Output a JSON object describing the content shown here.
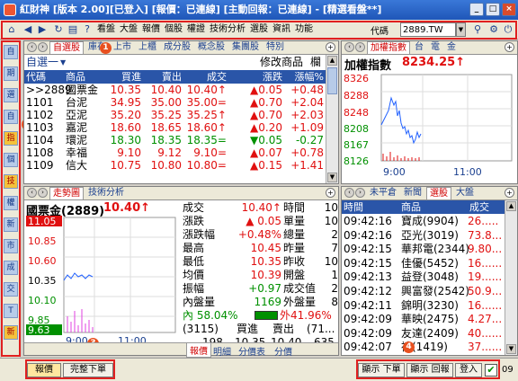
{
  "window": {
    "title": "紅財神 [版本 2.00][已登入] [報價：已連線] [主動回報：已連線] - [精選看盤**]",
    "buttons": [
      "_",
      "□",
      "×"
    ]
  },
  "toolbar": {
    "menu": [
      "看盤",
      "大盤",
      "報價",
      "個股",
      "權證",
      "技術分析",
      "選股",
      "資訊",
      "功能"
    ],
    "code_label": "代碼",
    "code_value": "2889.TW"
  },
  "sidebar": {
    "items": [
      "自",
      "期",
      "選",
      "自",
      "指",
      "個",
      "技",
      "權",
      "新",
      "市",
      "成",
      "交",
      "T",
      "新"
    ]
  },
  "watchlist": {
    "tabs": [
      "自選股",
      "庫存",
      "上市",
      "上櫃",
      "成分股",
      "概念股",
      "集團股",
      "特別"
    ],
    "group": "自選一",
    "modify": "修改商品",
    "field": "欄位",
    "columns": [
      "代碼",
      "商品",
      "買進",
      "賣出",
      "成交",
      "漲跌",
      "漲幅%"
    ],
    "rows": [
      {
        "code": ">>2889",
        "name": "國票金",
        "bid": "10.35",
        "ask": "10.40",
        "last": "10.40↑",
        "chg": "▲0.05",
        "pct": "+0.48",
        "dir": "up"
      },
      {
        "code": "1101",
        "name": "台泥",
        "bid": "34.95",
        "ask": "35.00",
        "last": "35.00=",
        "chg": "▲0.70",
        "pct": "+2.04",
        "dir": "up"
      },
      {
        "code": "1102",
        "name": "亞泥",
        "bid": "35.20",
        "ask": "35.25",
        "last": "35.25↑",
        "chg": "▲0.70",
        "pct": "+2.03",
        "dir": "up"
      },
      {
        "code": "1103",
        "name": "嘉泥",
        "bid": "18.60",
        "ask": "18.65",
        "last": "18.60↑",
        "chg": "▲0.20",
        "pct": "+1.09",
        "dir": "up"
      },
      {
        "code": "1104",
        "name": "環泥",
        "bid": "18.30",
        "ask": "18.35",
        "last": "18.35=",
        "chg": "▼0.05",
        "pct": "-0.27",
        "dir": "dn"
      },
      {
        "code": "1108",
        "name": "幸福",
        "bid": "9.10",
        "ask": "9.12",
        "last": "9.10=",
        "chg": "▲0.07",
        "pct": "+0.78",
        "dir": "up"
      },
      {
        "code": "1109",
        "name": "信大",
        "bid": "10.75",
        "ask": "10.80",
        "last": "10.80=",
        "chg": "▲0.15",
        "pct": "+1.41",
        "dir": "up"
      }
    ]
  },
  "index_panel": {
    "tabs": [
      "加權指數",
      "台",
      "電",
      "金"
    ],
    "title": "加權指數",
    "value": "8234.25↑",
    "y_ticks": [
      "8326",
      "8288",
      "8248",
      "8208",
      "8167",
      "8126"
    ],
    "x_ticks": [
      "9:00",
      "11:00"
    ]
  },
  "quote_panel": {
    "tabs": [
      "走勢圖",
      "技術分析"
    ],
    "stock": "國票金(2889)",
    "price": "10.40↑",
    "y_ticks": [
      "11.05",
      "10.85",
      "10.60",
      "10.35",
      "10.10",
      "9.85",
      "9.63"
    ],
    "x_ticks": [
      "9:00",
      "11:00"
    ],
    "fields": [
      {
        "label": "成交",
        "value": "10.40↑",
        "label2": "時間",
        "value2": "10"
      },
      {
        "label": "漲跌",
        "value": "▲ 0.05",
        "label2": "單量",
        "value2": "10"
      },
      {
        "label": "漲跌幅",
        "value": "+0.48%",
        "label2": "總量",
        "value2": "2"
      },
      {
        "label": "最高",
        "value": "10.45",
        "label2": "昨量",
        "value2": "7"
      },
      {
        "label": "最低",
        "value": "10.35",
        "label2": "昨收",
        "value2": "10"
      },
      {
        "label": "均價",
        "value": "10.39",
        "label2": "開盤",
        "value2": "1"
      },
      {
        "label": "振幅",
        "value": "+0.97",
        "label2": "成交值",
        "value2": "2"
      },
      {
        "label": "內盤量",
        "value": "1169",
        "label2": "外盤量",
        "value2": "8"
      }
    ],
    "inner_pct": "內 58.04%",
    "outer_pct": "外41.96%",
    "bidask_head": [
      "(3115)",
      "買進",
      "賣出",
      "(71..."
    ],
    "bidask_row": [
      "198",
      "10.35",
      "10.40",
      "635"
    ],
    "bottom_tabs": [
      "報價",
      "明細",
      "分價表",
      "分價"
    ]
  },
  "ticks_panel": {
    "tabs": [
      "未平倉",
      "新聞",
      "選股",
      "大盤"
    ],
    "columns": [
      "時間",
      "商品",
      "成交"
    ],
    "rows": [
      {
        "time": "09:42:16",
        "name": "寶成(9904)",
        "price": "26....."
      },
      {
        "time": "09:42:16",
        "name": "亞光(3019)",
        "price": "73.8..."
      },
      {
        "time": "09:42:15",
        "name": "華邦電(2344)",
        "price": "9.80..."
      },
      {
        "time": "09:42:15",
        "name": "佳優(5452)",
        "price": "16......"
      },
      {
        "time": "09:42:13",
        "name": "益登(3048)",
        "price": "19......"
      },
      {
        "time": "09:42:12",
        "name": "興富發(2542)",
        "price": "50.9..."
      },
      {
        "time": "09:42:11",
        "name": "錦明(3230)",
        "price": "16......"
      },
      {
        "time": "09:42:09",
        "name": "華映(2475)",
        "price": "4.27..."
      },
      {
        "time": "09:42:09",
        "name": "友達(2409)",
        "price": "40......"
      },
      {
        "time": "09:42:07",
        "name": "禧(1419)",
        "price": "37......"
      }
    ]
  },
  "bottombar": {
    "left_tabs": [
      "報價",
      "完整下單"
    ],
    "right_buttons": [
      "顯示 下單",
      "顯示 回報",
      "登入"
    ],
    "status": "09"
  },
  "markers": [
    "1",
    "2",
    "3",
    "4"
  ],
  "colors": {
    "up": "#e01010",
    "down": "#009000",
    "header": "#2a55a8",
    "highlight": "#e02020"
  }
}
